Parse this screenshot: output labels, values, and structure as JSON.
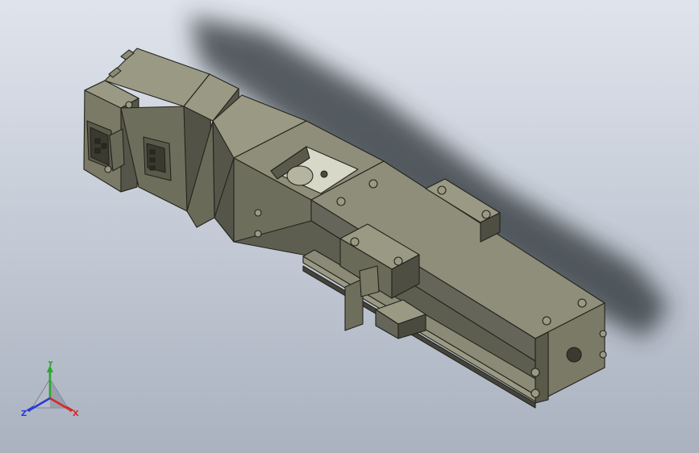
{
  "viewport": {
    "background_top": "#dfe4ec",
    "background_bottom": "#aab2c0"
  },
  "model": {
    "body_color": "#6e6e5c",
    "body_light": "#8e8e7a",
    "body_dark": "#4a4a3e",
    "edge_color": "#23231d"
  },
  "triad": {
    "x_label": "X",
    "y_label": "Y",
    "z_label": "Z",
    "x_color": "#d42a2a",
    "y_color": "#2aa82a",
    "z_color": "#2a3ad4"
  }
}
